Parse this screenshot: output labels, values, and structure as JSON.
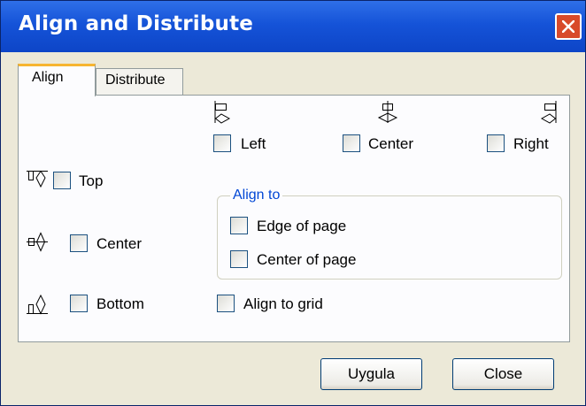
{
  "window": {
    "title": "Align and Distribute"
  },
  "tabs": {
    "align": "Align",
    "distribute": "Distribute"
  },
  "horizontal": {
    "left": "Left",
    "center": "Center",
    "right": "Right"
  },
  "vertical": {
    "top": "Top",
    "center": "Center",
    "bottom": "Bottom"
  },
  "align_to": {
    "legend": "Align to",
    "edge": "Edge of page",
    "center": "Center of page"
  },
  "grid": {
    "label": "Align to grid"
  },
  "buttons": {
    "apply": "Uygula",
    "close": "Close"
  },
  "colors": {
    "title_bar": "#1553d8",
    "close_button": "#d84a2a",
    "group_legend": "#0046d5",
    "active_tab_highlight": "#f6b530"
  },
  "icons": [
    "close-icon",
    "align-left-icon",
    "align-horizontal-center-icon",
    "align-right-icon",
    "align-top-icon",
    "align-vertical-center-icon",
    "align-bottom-icon"
  ]
}
